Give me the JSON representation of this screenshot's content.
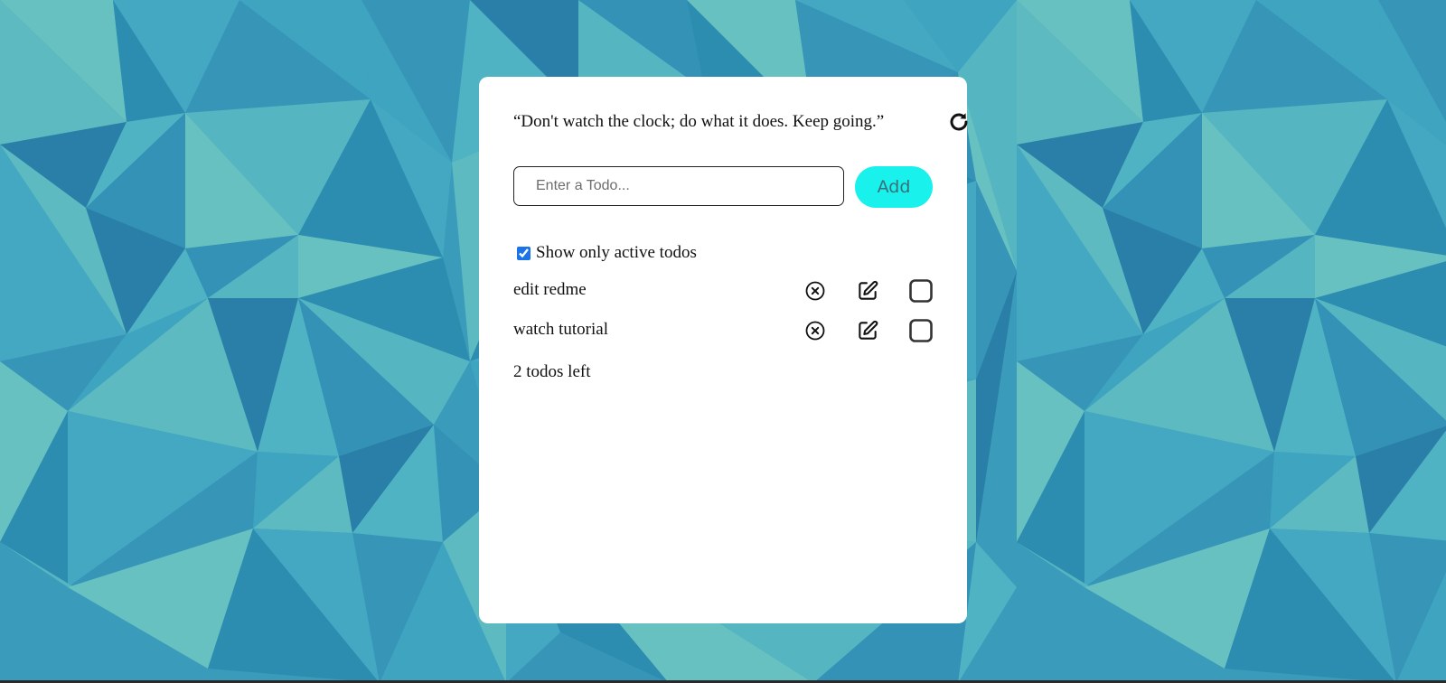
{
  "colors": {
    "background": "#3a9cba",
    "card": "#ffffff",
    "add_button": "#19f1ec",
    "add_button_text": "#3b6f78",
    "checkbox_accent": "#1a73e8"
  },
  "quote": {
    "text": "“Don't watch the clock; do what it does. Keep going.”",
    "refresh_icon": "refresh-icon"
  },
  "new_todo": {
    "placeholder": "Enter a Todo...",
    "value": "",
    "add_label": "Add"
  },
  "filter": {
    "label": "Show only active todos",
    "checked": true
  },
  "todos": [
    {
      "text": "edit redme",
      "completed": false
    },
    {
      "text": "watch tutorial",
      "completed": false
    }
  ],
  "row_icons": [
    "close-circle-icon",
    "edit-icon",
    "checkbox-square-icon"
  ],
  "footer": {
    "count_text": "2 todos left"
  }
}
